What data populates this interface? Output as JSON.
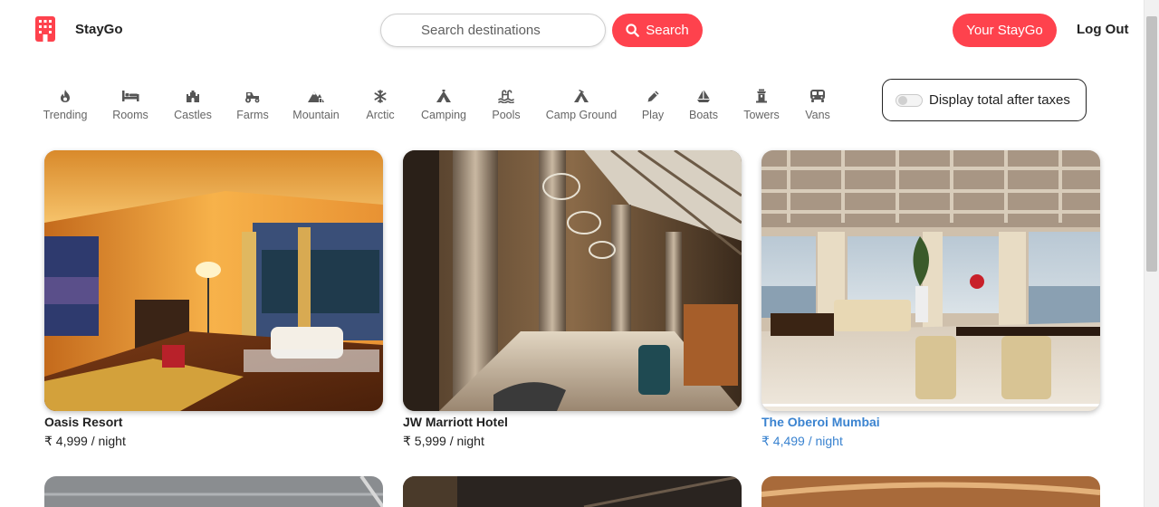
{
  "brand": {
    "name": "StayGo"
  },
  "search": {
    "placeholder": "Search destinations",
    "button_label": "Search"
  },
  "nav": {
    "your_button": "Your StayGo",
    "logout": "Log Out"
  },
  "filters": [
    {
      "label": "Trending",
      "icon": "fire-icon"
    },
    {
      "label": "Rooms",
      "icon": "bed-icon"
    },
    {
      "label": "Castles",
      "icon": "castle-icon"
    },
    {
      "label": "Farms",
      "icon": "tractor-icon"
    },
    {
      "label": "Mountain",
      "icon": "mountain-icon"
    },
    {
      "label": "Arctic",
      "icon": "snowflake-icon"
    },
    {
      "label": "Camping",
      "icon": "tent-icon"
    },
    {
      "label": "Pools",
      "icon": "pool-icon"
    },
    {
      "label": "Camp Ground",
      "icon": "campground-icon"
    },
    {
      "label": "Play",
      "icon": "pen-icon"
    },
    {
      "label": "Boats",
      "icon": "sailboat-icon"
    },
    {
      "label": "Towers",
      "icon": "tower-icon"
    },
    {
      "label": "Vans",
      "icon": "van-icon"
    }
  ],
  "tax_toggle": {
    "label": "Display total after taxes",
    "checked": false
  },
  "listings": [
    {
      "title": "Oasis Resort",
      "price": "₹ 4,999 / night"
    },
    {
      "title": "JW Marriott Hotel",
      "price": "₹ 5,999 / night"
    },
    {
      "title": "The Oberoi Mumbai",
      "price": "₹ 4,499 / night",
      "state": "hover"
    }
  ],
  "colors": {
    "accent": "#fe424d",
    "hover_text": "#3a83d0"
  }
}
